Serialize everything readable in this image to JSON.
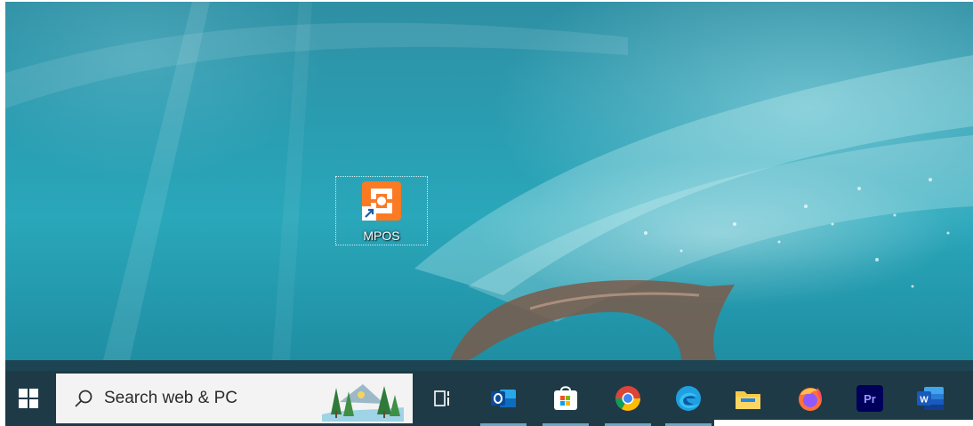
{
  "desktop": {
    "shortcut": {
      "label": "MPOS",
      "icon": "xampp-icon"
    }
  },
  "taskbar": {
    "start": {
      "icon": "windows-logo-icon"
    },
    "search": {
      "placeholder": "Search web & PC",
      "icon": "search-icon"
    },
    "task_view": {
      "icon": "task-view-icon"
    },
    "apps": [
      {
        "name": "Outlook",
        "icon": "outlook-icon",
        "color": "#0f6cbd"
      },
      {
        "name": "Microsoft Store",
        "icon": "store-icon",
        "color": "#f25022"
      },
      {
        "name": "Chrome",
        "icon": "chrome-icon",
        "color": "#fbbc05"
      },
      {
        "name": "Edge",
        "icon": "edge-icon",
        "color": "#1fa0e0"
      },
      {
        "name": "File Explorer",
        "icon": "folder-icon",
        "color": "#f7c948"
      },
      {
        "name": "Firefox",
        "icon": "firefox-icon",
        "color": "#ff7139"
      },
      {
        "name": "Premiere Pro",
        "icon": "premiere-pro-icon",
        "label": "Pr",
        "color": "#9999ff"
      },
      {
        "name": "Word",
        "icon": "word-icon",
        "label": "W",
        "color": "#2b579a"
      }
    ]
  }
}
